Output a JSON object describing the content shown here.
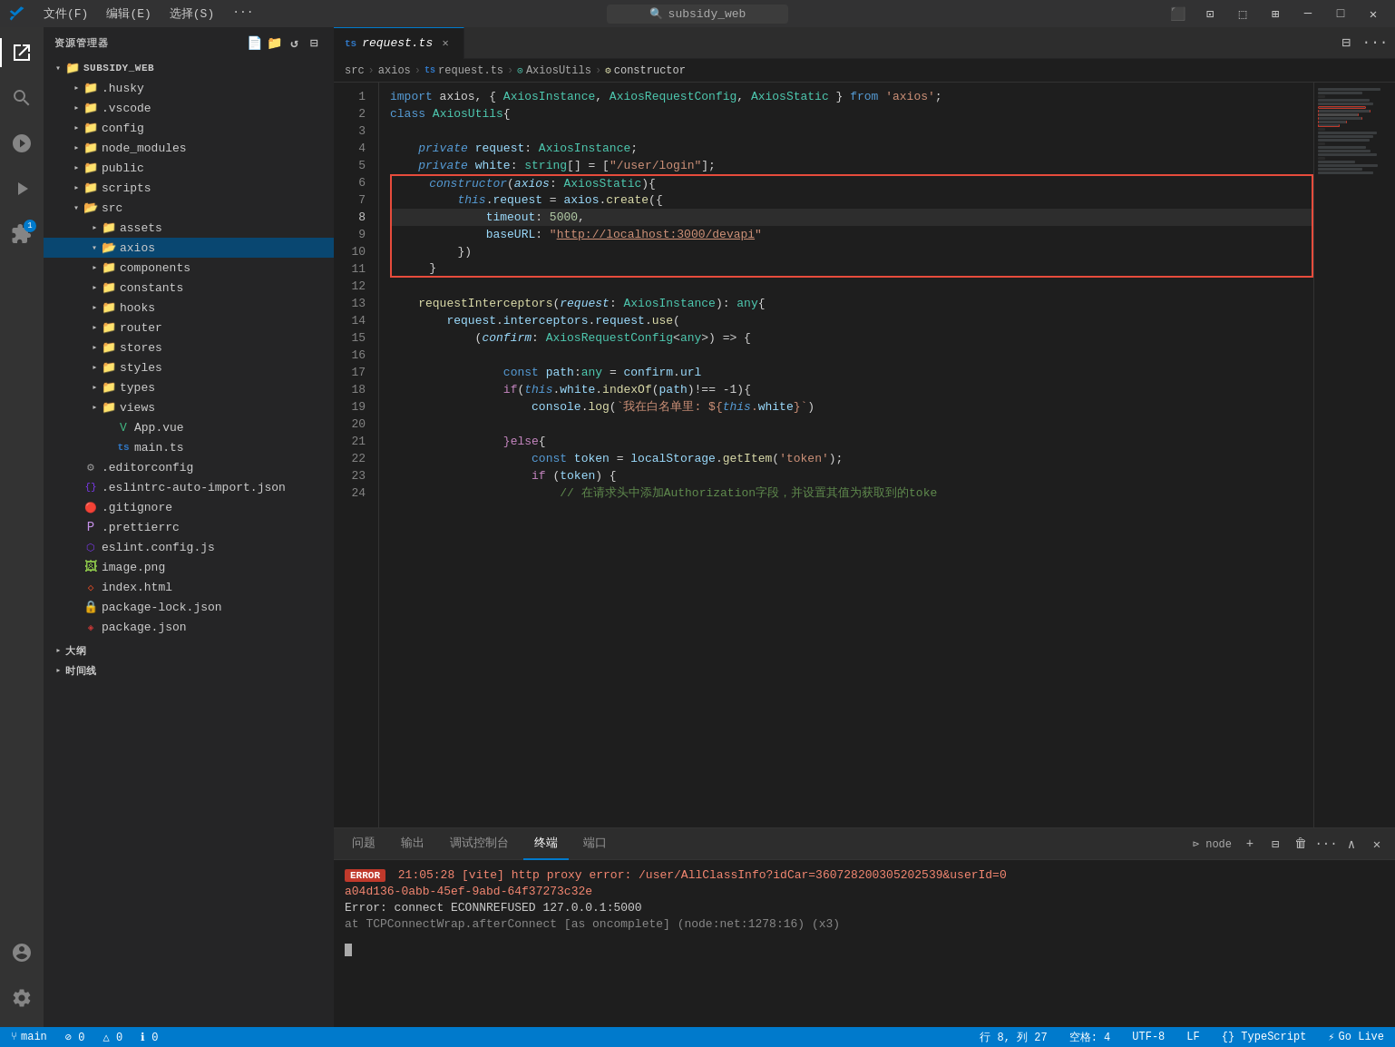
{
  "titlebar": {
    "logo": "VS",
    "menu": [
      "文件(F)",
      "编辑(E)",
      "选择(S)",
      "···"
    ],
    "search_placeholder": "subsidy_web",
    "buttons": [
      "sidebar-toggle",
      "layout-toggle",
      "split-toggle",
      "grid-toggle",
      "minimize",
      "maximize",
      "close"
    ]
  },
  "sidebar": {
    "header": "资源管理器",
    "root": "SUBSIDY_WEB",
    "tree": [
      {
        "id": "husky",
        "label": ".husky",
        "type": "folder",
        "depth": 1
      },
      {
        "id": "vscode",
        "label": ".vscode",
        "type": "folder",
        "depth": 1
      },
      {
        "id": "config",
        "label": "config",
        "type": "folder",
        "depth": 1
      },
      {
        "id": "node_modules",
        "label": "node_modules",
        "type": "folder",
        "depth": 1
      },
      {
        "id": "public",
        "label": "public",
        "type": "folder",
        "depth": 1
      },
      {
        "id": "scripts",
        "label": "scripts",
        "type": "folder",
        "depth": 1
      },
      {
        "id": "src",
        "label": "src",
        "type": "folder-open",
        "depth": 1,
        "expanded": true
      },
      {
        "id": "assets",
        "label": "assets",
        "type": "folder",
        "depth": 2
      },
      {
        "id": "axios",
        "label": "axios",
        "type": "folder-open",
        "depth": 2,
        "expanded": true,
        "active": true
      },
      {
        "id": "components",
        "label": "components",
        "type": "folder",
        "depth": 2
      },
      {
        "id": "constants",
        "label": "constants",
        "type": "folder",
        "depth": 2
      },
      {
        "id": "hooks",
        "label": "hooks",
        "type": "folder",
        "depth": 2
      },
      {
        "id": "router",
        "label": "router",
        "type": "folder",
        "depth": 2
      },
      {
        "id": "stores",
        "label": "stores",
        "type": "folder",
        "depth": 2
      },
      {
        "id": "styles",
        "label": "styles",
        "type": "folder",
        "depth": 2
      },
      {
        "id": "types",
        "label": "types",
        "type": "folder",
        "depth": 2
      },
      {
        "id": "views",
        "label": "views",
        "type": "folder",
        "depth": 2
      },
      {
        "id": "appvue",
        "label": "App.vue",
        "type": "vue",
        "depth": 2
      },
      {
        "id": "maints",
        "label": "main.ts",
        "type": "ts",
        "depth": 2
      },
      {
        "id": "editorconfig",
        "label": ".editorconfig",
        "type": "editor",
        "depth": 1
      },
      {
        "id": "eslintauto",
        "label": ".eslintrc-auto-import.json",
        "type": "eslint",
        "depth": 1
      },
      {
        "id": "gitignore",
        "label": ".gitignore",
        "type": "git",
        "depth": 1
      },
      {
        "id": "prettierrc",
        "label": ".prettierrc",
        "type": "prettier",
        "depth": 1
      },
      {
        "id": "eslintconfig",
        "label": "eslint.config.js",
        "type": "eslint",
        "depth": 1
      },
      {
        "id": "imagepng",
        "label": "image.png",
        "type": "image",
        "depth": 1
      },
      {
        "id": "indexhtml",
        "label": "index.html",
        "type": "html",
        "depth": 1
      },
      {
        "id": "packagelock",
        "label": "package-lock.json",
        "type": "lock",
        "depth": 1
      },
      {
        "id": "packagejson",
        "label": "package.json",
        "type": "pkg",
        "depth": 1
      }
    ],
    "bottom_items": [
      "大纲",
      "时间线"
    ]
  },
  "tabs": [
    {
      "id": "request-ts",
      "label": "request.ts",
      "type": "ts",
      "active": true,
      "modified": false
    }
  ],
  "breadcrumb": [
    {
      "label": "src"
    },
    {
      "label": "axios"
    },
    {
      "label": "request.ts",
      "type": "ts"
    },
    {
      "label": "AxiosUtils"
    },
    {
      "label": "constructor"
    }
  ],
  "code": {
    "lines": [
      {
        "n": 1,
        "content": "import_axios_line"
      },
      {
        "n": 2,
        "content": "class_line"
      },
      {
        "n": 3,
        "content": "empty"
      },
      {
        "n": 4,
        "content": "private_request"
      },
      {
        "n": 5,
        "content": "private_white"
      },
      {
        "n": 6,
        "content": "constructor_open",
        "box": true,
        "box_top": true
      },
      {
        "n": 7,
        "content": "this_request_line",
        "box": true
      },
      {
        "n": 8,
        "content": "timeout_line",
        "box": true,
        "highlight": true
      },
      {
        "n": 9,
        "content": "baseurl_line",
        "box": true
      },
      {
        "n": 10,
        "content": "close_bracket_line",
        "box": true
      },
      {
        "n": 11,
        "content": "close_brace_line",
        "box": true,
        "box_bottom": true
      },
      {
        "n": 12,
        "content": "empty"
      },
      {
        "n": 13,
        "content": "request_interceptors_line"
      },
      {
        "n": 14,
        "content": "request_interceptors_use"
      },
      {
        "n": 15,
        "content": "confirm_line"
      },
      {
        "n": 16,
        "content": "empty"
      },
      {
        "n": 17,
        "content": "const_path_line"
      },
      {
        "n": 18,
        "content": "if_white_line"
      },
      {
        "n": 19,
        "content": "console_log_line"
      },
      {
        "n": 20,
        "content": "empty"
      },
      {
        "n": 21,
        "content": "else_open"
      },
      {
        "n": 22,
        "content": "const_token_line"
      },
      {
        "n": 23,
        "content": "if_token_line"
      },
      {
        "n": 24,
        "content": "comment_line"
      }
    ]
  },
  "terminal": {
    "tabs": [
      "问题",
      "输出",
      "调试控制台",
      "终端",
      "端口"
    ],
    "active_tab": "终端",
    "node_label": "node",
    "error_badge": "ERROR",
    "error_time": "21:05:28",
    "error_msg_1": "[vite] http proxy error: /user/AllClassInfo?idCar=360728200305202539&userId=0",
    "error_msg_2": "a04d136-0abb-45ef-9abd-64f37273c32e",
    "error_line2": "Error: connect ECONNREFUSED 127.0.0.1:5000",
    "error_line3": "    at TCPConnectWrap.afterConnect [as oncomplete] (node:net:1278:16) (x3)"
  },
  "statusbar": {
    "left": [
      "⓪ 0△ 0",
      "⚠ 0"
    ],
    "right": [
      "行 8, 列 27",
      "空格:4",
      "UTF-8",
      "LF",
      "{} TypeScript",
      "⚡ Go Live"
    ]
  }
}
